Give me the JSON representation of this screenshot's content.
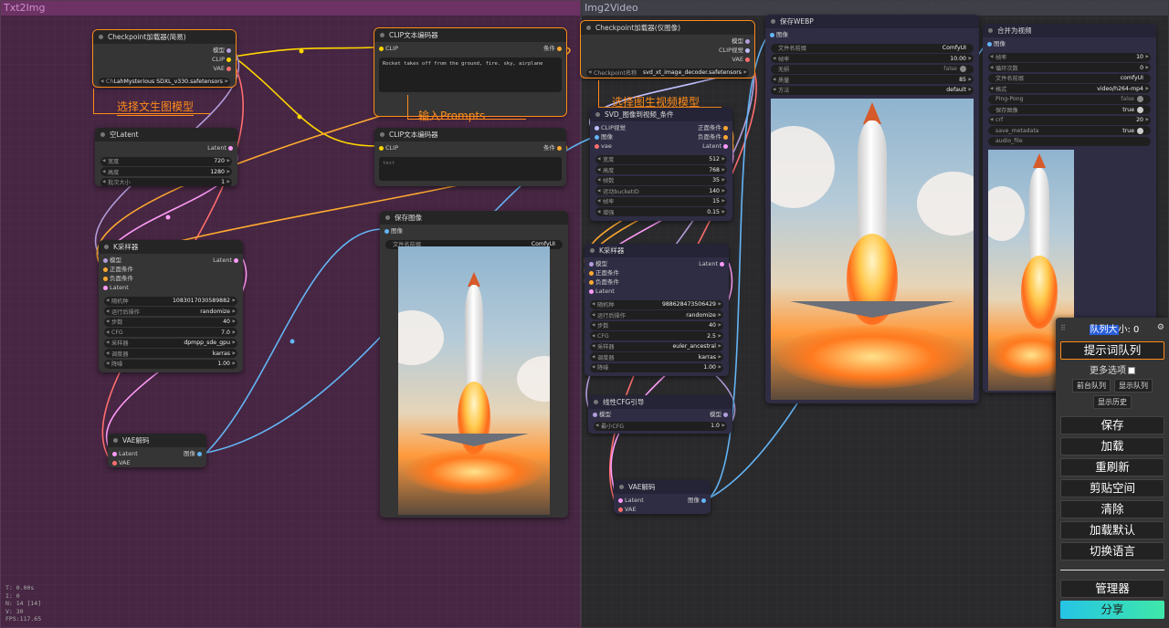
{
  "groups": {
    "txt2img": "Txt2Img",
    "img2video": "Img2Video"
  },
  "nodes": {
    "ckpt1": {
      "title": "Checkpoint加载器(简易)",
      "outputs": [
        "模型",
        "CLIP",
        "VAE"
      ],
      "widget_label": "Che",
      "widget_value": "LahMysterious SDXL_v330.safetensors"
    },
    "clip1": {
      "title": "CLIP文本编码器",
      "input": "CLIP",
      "output": "条件",
      "text": "Rocket takes off from the ground, fire. sky, airplane"
    },
    "clip2": {
      "title": "CLIP文本编码器",
      "input": "CLIP",
      "output": "条件",
      "text": "text"
    },
    "latent": {
      "title": "空Latent",
      "output": "Latent",
      "widgets": [
        {
          "label": "宽度",
          "value": "720"
        },
        {
          "label": "高度",
          "value": "1280"
        },
        {
          "label": "批次大小",
          "value": "1"
        }
      ]
    },
    "ksampler1": {
      "title": "K采样器",
      "inputs": [
        "模型",
        "正面条件",
        "负面条件",
        "Latent"
      ],
      "output": "Latent",
      "widgets": [
        {
          "label": "随机种",
          "value": "1083017030589882"
        },
        {
          "label": "运行后操作",
          "value": "randomize"
        },
        {
          "label": "步数",
          "value": "40"
        },
        {
          "label": "CFG",
          "value": "7.0"
        },
        {
          "label": "采样器",
          "value": "dpmpp_sde_gpu"
        },
        {
          "label": "调度器",
          "value": "karras"
        },
        {
          "label": "降噪",
          "value": "1.00"
        }
      ]
    },
    "vaedecode1": {
      "title": "VAE解码",
      "inputs": [
        "Latent",
        "VAE"
      ],
      "output": "图像"
    },
    "saveimage": {
      "title": "保存图像",
      "input": "图像",
      "widget_label": "文件名前缀",
      "widget_value": "ComfyUI"
    },
    "ckpt2": {
      "title": "Checkpoint加载器(仅图像)",
      "outputs": [
        "模型",
        "CLIP视觉",
        "VAE"
      ],
      "widget_label": "Checkpoint名称",
      "widget_value": "svd_xt_image_decoder.safetensors"
    },
    "svd": {
      "title": "SVD_图像到视频_条件",
      "inputs": [
        "CLIP视觉",
        "图像",
        "vae"
      ],
      "outputs": [
        "正面条件",
        "负面条件",
        "Latent"
      ],
      "widgets": [
        {
          "label": "宽度",
          "value": "512"
        },
        {
          "label": "高度",
          "value": "768"
        },
        {
          "label": "帧数",
          "value": "35"
        },
        {
          "label": "运动bucketID",
          "value": "140"
        },
        {
          "label": "帧率",
          "value": "15"
        },
        {
          "label": "增强",
          "value": "0.15"
        }
      ]
    },
    "ksampler2": {
      "title": "K采样器",
      "inputs": [
        "模型",
        "正面条件",
        "负面条件",
        "Latent"
      ],
      "output": "Latent",
      "widgets": [
        {
          "label": "随机种",
          "value": "988628473506429"
        },
        {
          "label": "运行后操作",
          "value": "randomize"
        },
        {
          "label": "步数",
          "value": "40"
        },
        {
          "label": "CFG",
          "value": "2.5"
        },
        {
          "label": "采样器",
          "value": "euler_ancestral"
        },
        {
          "label": "调度器",
          "value": "karras"
        },
        {
          "label": "降噪",
          "value": "1.00"
        }
      ]
    },
    "linearcfg": {
      "title": "线性CFG引导",
      "input": "模型",
      "output": "模型",
      "widget_label": "最小CFG",
      "widget_value": "1.0"
    },
    "vaedecode2": {
      "title": "VAE解码",
      "inputs": [
        "Latent",
        "VAE"
      ],
      "output": "图像"
    },
    "savewebp": {
      "title": "保存WEBP",
      "input": "图像",
      "widgets": [
        {
          "label": "文件名前缀",
          "value": "ComfyUI"
        },
        {
          "label": "帧率",
          "value": "10.00"
        },
        {
          "label": "无损",
          "value": "false"
        },
        {
          "label": "质量",
          "value": "85"
        },
        {
          "label": "方法",
          "value": "default"
        }
      ]
    },
    "combine": {
      "title": "合并为视频",
      "input": "图像",
      "widgets": [
        {
          "label": "帧率",
          "value": "10"
        },
        {
          "label": "循环次数",
          "value": "0"
        },
        {
          "label": "文件名前缀",
          "value": "comfyUI"
        },
        {
          "label": "格式",
          "value": "video/h264-mp4"
        },
        {
          "label": "Ping-Pong",
          "value": "false"
        },
        {
          "label": "保存图像",
          "value": "true"
        },
        {
          "label": "crf",
          "value": "20"
        },
        {
          "label": "save_metadata",
          "value": "true"
        },
        {
          "label": "audio_file",
          "value": ""
        }
      ]
    }
  },
  "annotations": {
    "txt2img_model": "选择文生图模型",
    "prompts": "输入Prompts",
    "img2video_model": "选择图生视频模型"
  },
  "stats": [
    "T: 0.00s",
    "I: 0",
    "N: 14 [14]",
    "V: 30",
    "FPS:117.65"
  ],
  "menu": {
    "queue_highlight": "队列大",
    "queue_rest": "小: 0",
    "queue_prompt": "提示词队列",
    "more_options": "更多选项",
    "front_queue": "前台队列",
    "view_queue": "显示队列",
    "view_history": "显示历史",
    "buttons": [
      "保存",
      "加载",
      "重刷新",
      "剪贴空间",
      "清除",
      "加载默认",
      "切换语言"
    ],
    "manager": "管理器",
    "share": "分享"
  },
  "colors": {
    "accent": "#ff8c1a",
    "clip_wire": "#ffd500",
    "model_wire": "#b39ddb",
    "vae_wire": "#ff6e6e",
    "latent_wire": "#ff9cf9",
    "image_wire": "#64b5f6",
    "cond_wire": "#ffa931"
  }
}
